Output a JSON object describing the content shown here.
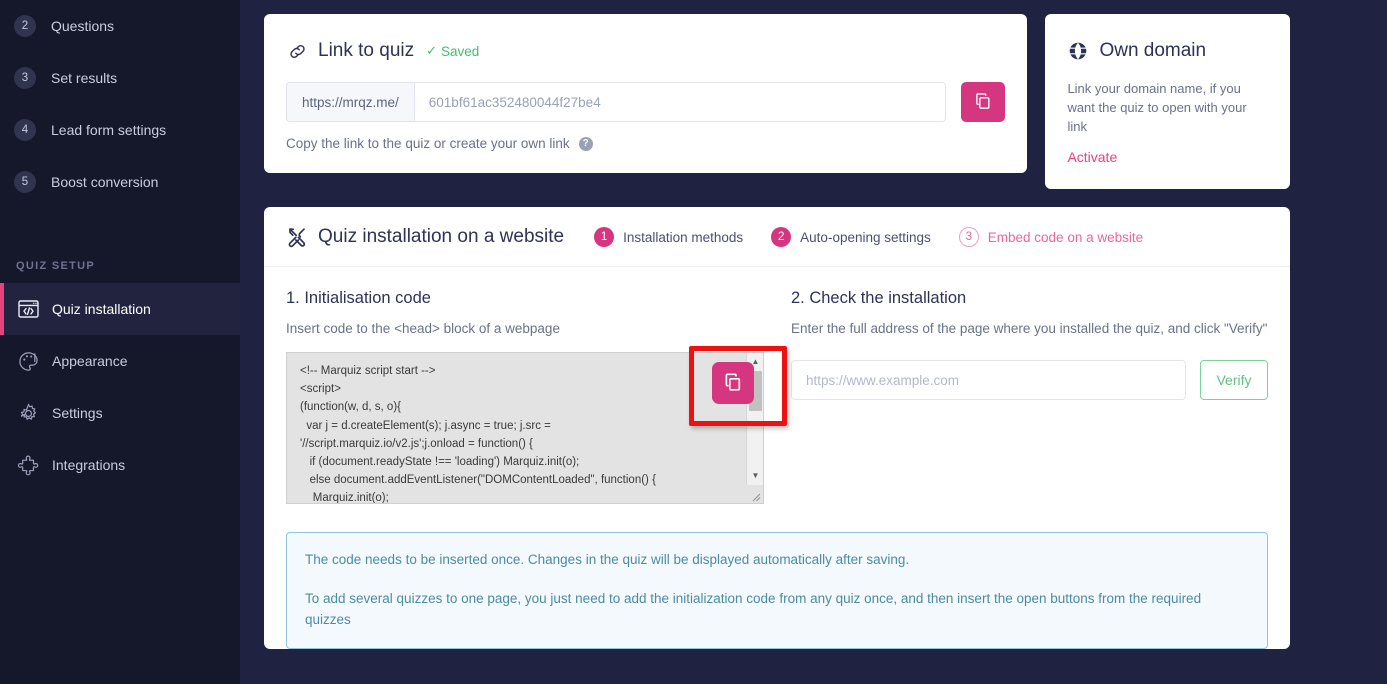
{
  "sidebar": {
    "numbered_items": [
      {
        "num": "2",
        "label": "Questions"
      },
      {
        "num": "3",
        "label": "Set results"
      },
      {
        "num": "4",
        "label": "Lead form settings"
      },
      {
        "num": "5",
        "label": "Boost conversion"
      }
    ],
    "section_title": "QUIZ SETUP",
    "items": [
      {
        "label": "Quiz installation",
        "icon": "code-window-icon",
        "active": true
      },
      {
        "label": "Appearance",
        "icon": "palette-icon",
        "active": false
      },
      {
        "label": "Settings",
        "icon": "gear-icon",
        "active": false
      },
      {
        "label": "Integrations",
        "icon": "puzzle-piece-icon",
        "active": false
      }
    ],
    "accent_color": "#e8417f",
    "background_color": "#15172b"
  },
  "link_card": {
    "icon": "link-icon",
    "title": "Link to quiz",
    "saved_label": "Saved",
    "saved_color": "#3fbf6e",
    "url_prefix": "https://mrqz.me/",
    "url_value": "601bf61ac352480044f27be4",
    "copy_icon": "copy-icon",
    "hint": "Copy the link to the quiz or create your own link",
    "help_icon": "?"
  },
  "domain_card": {
    "icon": "globe-icon",
    "title": "Own domain",
    "description": "Link your domain name, if you want the quiz to open with your link",
    "activate_label": "Activate",
    "activate_color": "#e8417f"
  },
  "install": {
    "icon": "tools-icon",
    "title": "Quiz installation on a website",
    "steps": [
      {
        "num": "1",
        "label": "Installation methods",
        "state": "filled"
      },
      {
        "num": "2",
        "label": "Auto-opening settings",
        "state": "filled"
      },
      {
        "num": "3",
        "label": "Embed code on a website",
        "state": "outline"
      }
    ],
    "step_filled_color": "#d6367f",
    "left": {
      "title": "1. Initialisation code",
      "desc": "Insert code to the <head> block of a webpage",
      "code": "<!-- Marquiz script start -->\n<script>\n(function(w, d, s, o){\n  var j = d.createElement(s); j.async = true; j.src =\n'//script.marquiz.io/v2.js';j.onload = function() {\n   if (document.readyState !== 'loading') Marquiz.init(o);\n   else document.addEventListener(\"DOMContentLoaded\", function() {\n    Marquiz.init(o);",
      "copy_icon": "copy-icon",
      "scroll_up_icon": "▲",
      "scroll_down_icon": "▼",
      "resize_icon": "⁄⁄"
    },
    "right": {
      "title": "2. Check the installation",
      "desc": "Enter the full address of the page where you installed the quiz, and click \"Verify\"",
      "url_placeholder": "https://www.example.com",
      "url_value": "",
      "verify_label": "Verify",
      "verify_color": "#62c182"
    },
    "notice": [
      "The code needs to be inserted once. Changes in the quiz will be displayed automatically after saving.",
      "To add several quizzes to one page, you just need to add the initialization code from any quiz once, and then insert the open buttons from the required quizzes"
    ]
  },
  "annotation": {
    "highlight_color": "#ee1111",
    "target": "code-copy-button"
  }
}
